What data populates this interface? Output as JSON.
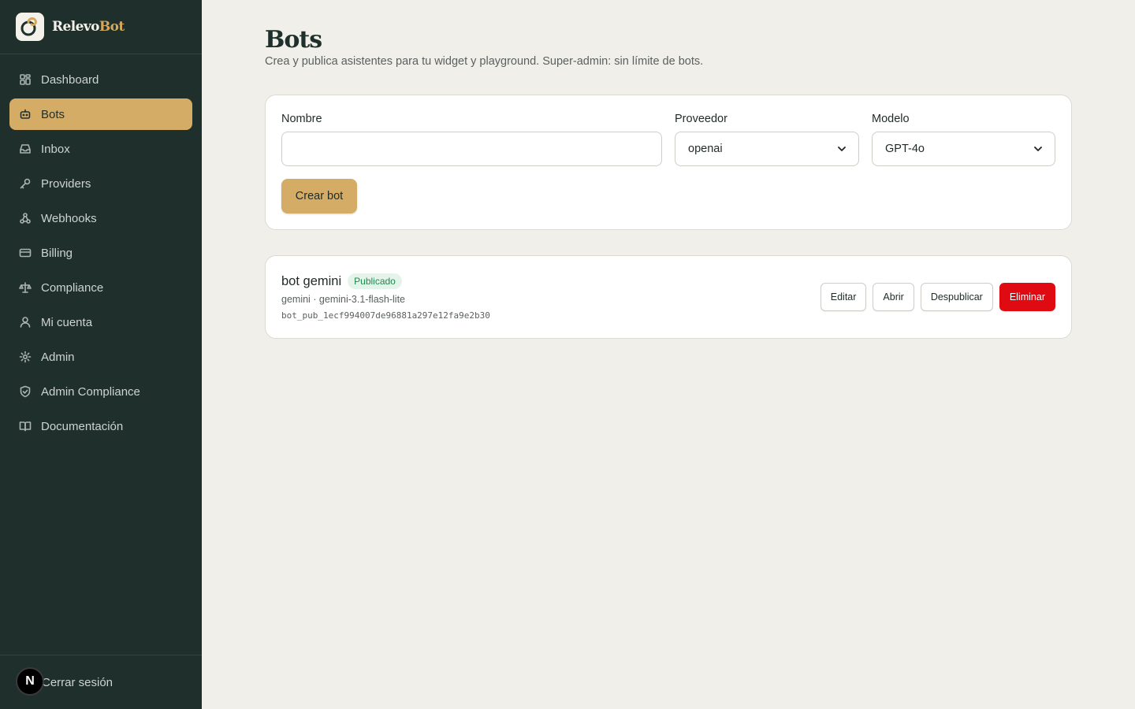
{
  "brand": {
    "name_a": "Relevo",
    "name_b": "Bot"
  },
  "sidebar": {
    "items": [
      {
        "label": "Dashboard",
        "icon": "dashboard-icon"
      },
      {
        "label": "Bots",
        "icon": "bot-icon",
        "active": true
      },
      {
        "label": "Inbox",
        "icon": "inbox-icon"
      },
      {
        "label": "Providers",
        "icon": "key-icon"
      },
      {
        "label": "Webhooks",
        "icon": "webhook-icon"
      },
      {
        "label": "Billing",
        "icon": "credit-card-icon"
      },
      {
        "label": "Compliance",
        "icon": "scale-icon"
      },
      {
        "label": "Mi cuenta",
        "icon": "user-icon"
      },
      {
        "label": "Admin",
        "icon": "gear-icon"
      },
      {
        "label": "Admin Compliance",
        "icon": "shield-icon"
      },
      {
        "label": "Documentación",
        "icon": "book-icon"
      }
    ],
    "logout_label": "Cerrar sesión",
    "avatar_letter": "N"
  },
  "page": {
    "title": "Bots",
    "subtitle": "Crea y publica asistentes para tu widget y playground. Super-admin: sin límite de bots."
  },
  "form": {
    "name_label": "Nombre",
    "name_value": "",
    "provider_label": "Proveedor",
    "provider_value": "openai",
    "model_label": "Modelo",
    "model_value": "GPT-4o",
    "submit_label": "Crear bot"
  },
  "bots": [
    {
      "name": "bot gemini",
      "status": "Publicado",
      "meta": "gemini · gemini-3.1-flash-lite",
      "key": "bot_pub_1ecf994007de96881a297e12fa9e2b30",
      "actions": {
        "edit": "Editar",
        "open": "Abrir",
        "unpublish": "Despublicar",
        "delete": "Eliminar"
      }
    }
  ],
  "colors": {
    "sidebar_bg": "#1f302c",
    "accent": "#d4ac66",
    "danger": "#e00b12",
    "success": "#1f8a4c"
  }
}
